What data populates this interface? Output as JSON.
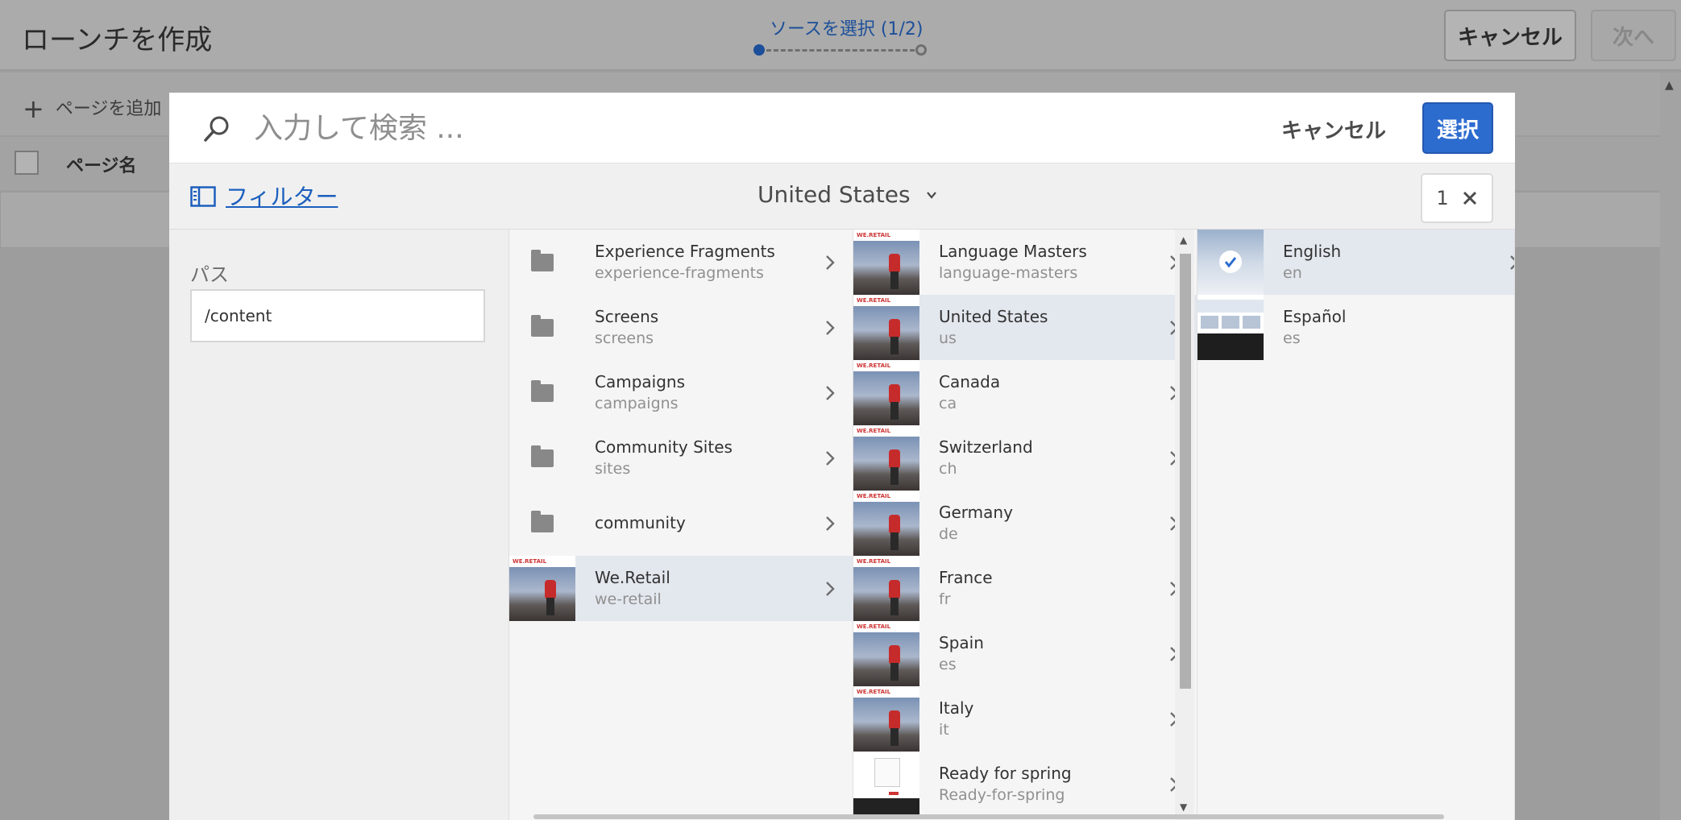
{
  "background_page": {
    "title": "ローンチを作成",
    "wizard_step_label": "ソースを選択 (1/2)",
    "cancel_label": "キャンセル",
    "next_label": "次へ",
    "add_page_label": "ページを追加",
    "column_header": "ページ名"
  },
  "modal": {
    "search_placeholder": "入力して検索 ...",
    "cancel_label": "キャンセル",
    "select_label": "選択",
    "filter_label": "フィルター",
    "breadcrumb_label": "United States",
    "selection_count": "1",
    "path_label": "パス",
    "path_value": "/content"
  },
  "columns": {
    "col1": [
      {
        "title": "Experience Fragments",
        "name": "experience-fragments",
        "thumb": "folder",
        "selected": false
      },
      {
        "title": "Screens",
        "name": "screens",
        "thumb": "folder",
        "selected": false
      },
      {
        "title": "Campaigns",
        "name": "campaigns",
        "thumb": "folder",
        "selected": false
      },
      {
        "title": "Community Sites",
        "name": "sites",
        "thumb": "folder",
        "selected": false
      },
      {
        "title": "community",
        "name": "",
        "thumb": "folder",
        "selected": false
      },
      {
        "title": "We.Retail",
        "name": "we-retail",
        "thumb": "photo",
        "selected": true
      }
    ],
    "col2": [
      {
        "title": "Language Masters",
        "name": "language-masters",
        "thumb": "photo",
        "selected": false
      },
      {
        "title": "United States",
        "name": "us",
        "thumb": "photo",
        "selected": true
      },
      {
        "title": "Canada",
        "name": "ca",
        "thumb": "photo",
        "selected": false
      },
      {
        "title": "Switzerland",
        "name": "ch",
        "thumb": "photo",
        "selected": false
      },
      {
        "title": "Germany",
        "name": "de",
        "thumb": "photo",
        "selected": false
      },
      {
        "title": "France",
        "name": "fr",
        "thumb": "photo",
        "selected": false
      },
      {
        "title": "Spain",
        "name": "es",
        "thumb": "photo",
        "selected": false
      },
      {
        "title": "Italy",
        "name": "it",
        "thumb": "photo",
        "selected": false
      },
      {
        "title": "Ready for spring",
        "name": "Ready-for-spring",
        "thumb": "doc",
        "selected": false
      }
    ],
    "col3": [
      {
        "title": "English",
        "name": "en",
        "thumb": "en",
        "selected": true,
        "checked": true
      },
      {
        "title": "Español",
        "name": "es",
        "thumb": "es",
        "selected": false,
        "checked": false
      }
    ]
  },
  "thumb_brand_text": "WE.RETAIL",
  "colors": {
    "accent_blue": "#2d6ccf",
    "link_blue": "#1c5fbd",
    "selected_row": "#e3e7ee",
    "overlay_gray": "#9d9d9d"
  }
}
